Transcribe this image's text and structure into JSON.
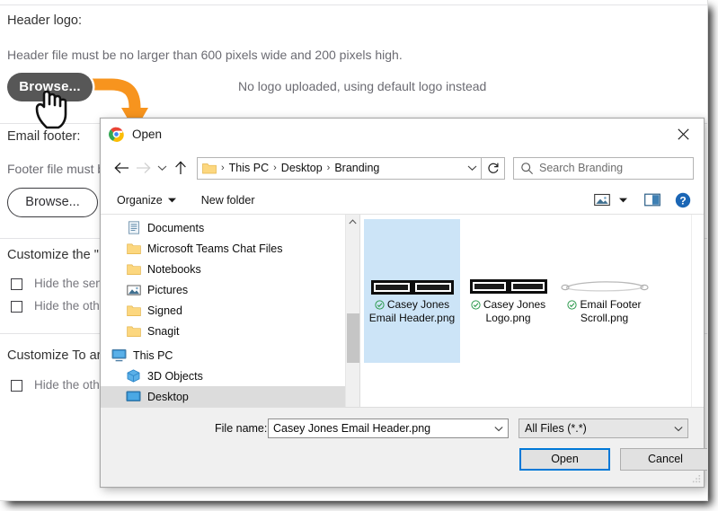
{
  "background_form": {
    "header_logo_label": "Header logo:",
    "header_note": "Header file must be no larger than 600 pixels wide and 200 pixels high.",
    "header_browse_label": "Browse...",
    "no_logo_status": "No logo uploaded, using default logo instead",
    "email_footer_label": "Email footer:",
    "footer_note": "Footer file must b",
    "footer_browse_label": "Browse...",
    "customize_from_heading": "Customize the \"",
    "customize_from_options": [
      "Hide the send",
      "Hide the othe"
    ],
    "customize_to_heading": "Customize To ar",
    "customize_to_options": [
      "Hide the othe"
    ]
  },
  "dialog": {
    "title": "Open",
    "title_icon": "chrome-icon",
    "close_icon": "close-icon",
    "nav": {
      "back_icon": "arrow-left-icon",
      "forward_icon": "arrow-right-icon",
      "recent_icon": "chevron-down-icon",
      "up_icon": "arrow-up-icon",
      "folder_icon": "folder-icon",
      "breadcrumbs": [
        "This PC",
        "Desktop",
        "Branding"
      ],
      "breadcrumb_separator": "›",
      "address_caret_icon": "chevron-down-icon",
      "refresh_icon": "refresh-icon",
      "search_icon": "search-icon",
      "search_placeholder": "Search Branding"
    },
    "commandbar": {
      "organize_label": "Organize",
      "organize_caret_icon": "caret-down-icon",
      "new_folder_label": "New folder",
      "view_icon": "view-layout-icon",
      "view_caret_icon": "caret-down-icon",
      "preview_pane_icon": "preview-pane-icon",
      "help_icon": "help-icon"
    },
    "nav_pane": {
      "items": [
        {
          "label": "Documents",
          "icon": "documents-icon",
          "indent": true,
          "selected": false
        },
        {
          "label": "Microsoft Teams Chat Files",
          "icon": "folder-icon",
          "indent": true,
          "selected": false
        },
        {
          "label": "Notebooks",
          "icon": "folder-icon",
          "indent": true,
          "selected": false
        },
        {
          "label": "Pictures",
          "icon": "pictures-icon",
          "indent": true,
          "selected": false
        },
        {
          "label": "Signed",
          "icon": "folder-icon",
          "indent": true,
          "selected": false
        },
        {
          "label": "Snagit",
          "icon": "folder-icon",
          "indent": true,
          "selected": false
        },
        {
          "label": "This PC",
          "icon": "this-pc-icon",
          "indent": false,
          "selected": false
        },
        {
          "label": "3D Objects",
          "icon": "3d-objects-icon",
          "indent": true,
          "selected": false
        },
        {
          "label": "Desktop",
          "icon": "desktop-icon",
          "indent": true,
          "selected": true
        }
      ],
      "scroll_up_icon": "chevron-up-icon",
      "scroll_down_icon": "chevron-down-icon"
    },
    "files": [
      {
        "name": "Casey Jones Email Header.png",
        "thumb": "casey-jones-logo-thumb",
        "badge_icon": "cloud-available-icon",
        "selected": true
      },
      {
        "name": "Casey Jones Logo.png",
        "thumb": "casey-jones-logo-thumb",
        "badge_icon": "cloud-available-icon",
        "selected": false
      },
      {
        "name": "Email Footer Scroll.png",
        "thumb": "scroll-divider-thumb",
        "badge_icon": "cloud-available-icon",
        "selected": false
      }
    ],
    "bottom": {
      "file_name_label": "File name:",
      "file_name_value": "Casey Jones Email Header.png",
      "file_name_caret_icon": "chevron-down-icon",
      "filter_value": "All Files (*.*)",
      "filter_caret_icon": "chevron-down-icon",
      "open_button": "Open",
      "cancel_button": "Cancel",
      "resize_grip_icon": "resize-grip-icon"
    }
  },
  "annotation": {
    "arrow_icon": "orange-curved-arrow",
    "arrow_color": "#F7941E",
    "cursor_icon": "hand-pointer-cursor"
  },
  "colors": {
    "accent_blue": "#0078d7",
    "selection_blue": "#cce4f7",
    "annotation_orange": "#F7941E",
    "dialog_chrome": "#f0f0f0",
    "button_dark": "#575757"
  }
}
